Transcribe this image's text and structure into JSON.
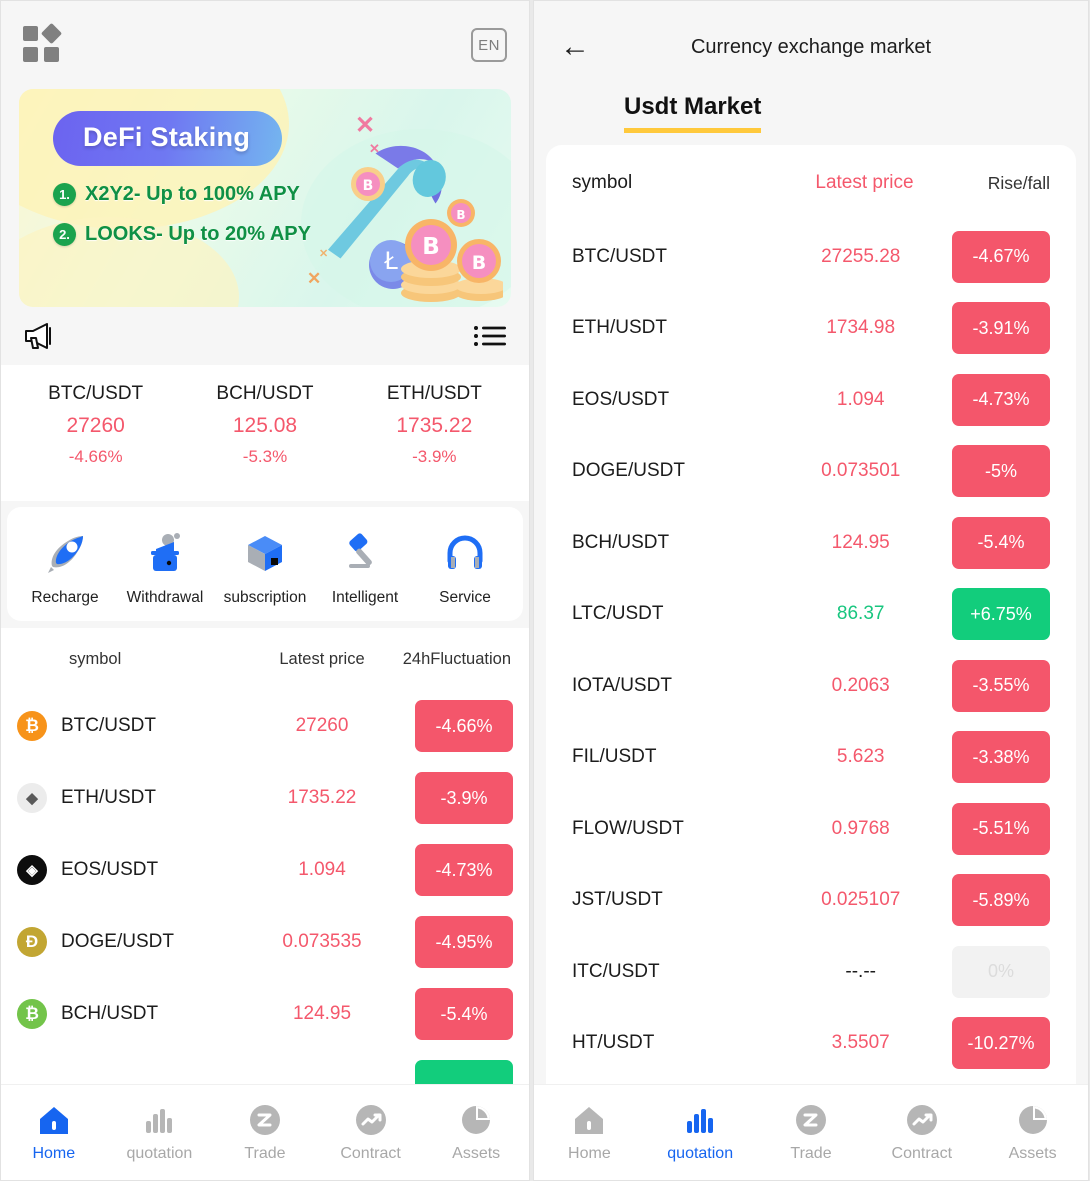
{
  "left": {
    "topbar": {
      "grid_icon": "apps-grid-icon",
      "lang_label": "EN"
    },
    "banner": {
      "title": "DeFi Staking",
      "items": [
        {
          "num": "1.",
          "text": "X2Y2- Up to 100% APY"
        },
        {
          "num": "2.",
          "text": "LOOKS- Up to 20% APY"
        }
      ]
    },
    "notice": {
      "megaphone_icon": "megaphone-icon",
      "list_icon": "list-icon",
      "text": ""
    },
    "tickers": [
      {
        "symbol": "BTC/USDT",
        "price": "27260",
        "change": "-4.66%"
      },
      {
        "symbol": "BCH/USDT",
        "price": "125.08",
        "change": "-5.3%"
      },
      {
        "symbol": "ETH/USDT",
        "price": "1735.22",
        "change": "-3.9%"
      }
    ],
    "quick_actions": [
      {
        "label": "Recharge",
        "icon": "rocket-icon"
      },
      {
        "label": "Withdrawal",
        "icon": "wallet-icon"
      },
      {
        "label": "subscription",
        "icon": "cube-icon"
      },
      {
        "label": "Intelligent",
        "icon": "gavel-icon"
      },
      {
        "label": "Service",
        "icon": "headset-icon"
      }
    ],
    "market": {
      "headers": {
        "symbol": "symbol",
        "price": "Latest price",
        "change": "24hFluctuation"
      },
      "rows": [
        {
          "symbol": "BTC/USDT",
          "price": "27260",
          "change": "-4.66%",
          "dir": "down",
          "coin_color": "#F7931A",
          "coin_glyph": "Ƀ",
          "coin_text": "#ffffff"
        },
        {
          "symbol": "ETH/USDT",
          "price": "1735.22",
          "change": "-3.9%",
          "dir": "down",
          "coin_color": "#ECECEC",
          "coin_glyph": "◆",
          "coin_text": "#5a5a5a"
        },
        {
          "symbol": "EOS/USDT",
          "price": "1.094",
          "change": "-4.73%",
          "dir": "down",
          "coin_color": "#0D0D0D",
          "coin_glyph": "◈",
          "coin_text": "#ffffff"
        },
        {
          "symbol": "DOGE/USDT",
          "price": "0.073535",
          "change": "-4.95%",
          "dir": "down",
          "coin_color": "#C2A633",
          "coin_glyph": "Ð",
          "coin_text": "#ffffff"
        },
        {
          "symbol": "BCH/USDT",
          "price": "124.95",
          "change": "-5.4%",
          "dir": "down",
          "coin_color": "#73C44A",
          "coin_glyph": "Ƀ",
          "coin_text": "#ffffff"
        }
      ],
      "partial_row_change_dir": "up"
    },
    "tabbar": {
      "active": "Home",
      "items": [
        {
          "label": "Home",
          "icon": "home-icon"
        },
        {
          "label": "quotation",
          "icon": "bars-icon"
        },
        {
          "label": "Trade",
          "icon": "trade-icon"
        },
        {
          "label": "Contract",
          "icon": "contract-icon"
        },
        {
          "label": "Assets",
          "icon": "assets-icon"
        }
      ]
    }
  },
  "right": {
    "header": {
      "back_icon": "back-arrow-icon",
      "title": "Currency exchange market"
    },
    "tab": {
      "label": "Usdt Market",
      "underline_color": "#ffc93c"
    },
    "headers": {
      "symbol": "symbol",
      "price": "Latest price",
      "change": "Rise/fall"
    },
    "rows": [
      {
        "symbol": "BTC/USDT",
        "price": "27255.28",
        "change": "-4.67%",
        "dir": "down"
      },
      {
        "symbol": "ETH/USDT",
        "price": "1734.98",
        "change": "-3.91%",
        "dir": "down"
      },
      {
        "symbol": "EOS/USDT",
        "price": "1.094",
        "change": "-4.73%",
        "dir": "down"
      },
      {
        "symbol": "DOGE/USDT",
        "price": "0.073501",
        "change": "-5%",
        "dir": "down"
      },
      {
        "symbol": "BCH/USDT",
        "price": "124.95",
        "change": "-5.4%",
        "dir": "down"
      },
      {
        "symbol": "LTC/USDT",
        "price": "86.37",
        "change": "+6.75%",
        "dir": "up"
      },
      {
        "symbol": "IOTA/USDT",
        "price": "0.2063",
        "change": "-3.55%",
        "dir": "down"
      },
      {
        "symbol": "FIL/USDT",
        "price": "5.623",
        "change": "-3.38%",
        "dir": "down"
      },
      {
        "symbol": "FLOW/USDT",
        "price": "0.9768",
        "change": "-5.51%",
        "dir": "down"
      },
      {
        "symbol": "JST/USDT",
        "price": "0.025107",
        "change": "-5.89%",
        "dir": "down"
      },
      {
        "symbol": "ITC/USDT",
        "price": "--.--",
        "change": "0%",
        "dir": "flat"
      },
      {
        "symbol": "HT/USDT",
        "price": "3.5507",
        "change": "-10.27%",
        "dir": "down"
      }
    ],
    "tabbar": {
      "active": "quotation",
      "items": [
        {
          "label": "Home",
          "icon": "home-icon"
        },
        {
          "label": "quotation",
          "icon": "bars-icon"
        },
        {
          "label": "Trade",
          "icon": "trade-icon"
        },
        {
          "label": "Contract",
          "icon": "contract-icon"
        },
        {
          "label": "Assets",
          "icon": "assets-icon"
        }
      ]
    }
  },
  "colors": {
    "down": "#f4566b",
    "up": "#12cd7c",
    "flat_bg": "#f2f2f2",
    "accent_blue": "#1665f0",
    "tab_underline": "#ffc93c"
  }
}
